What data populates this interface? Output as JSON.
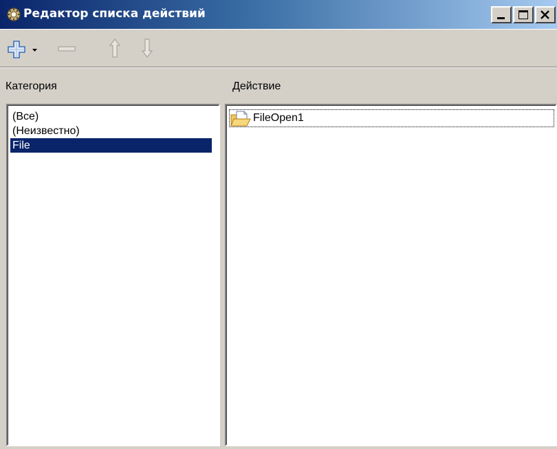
{
  "window": {
    "title": "Редактор списка действий",
    "title_icon": "actionlist-editor-icon",
    "caption_buttons": [
      "minimize-icon",
      "maximize-icon",
      "close-icon"
    ],
    "colors": {
      "titlebar_start": "#0a246a",
      "titlebar_end": "#a6caf0",
      "selection": "#0a246a",
      "face": "#d4d0c8"
    }
  },
  "toolbar": {
    "buttons": [
      {
        "icon": "add-icon",
        "has_dropdown": true,
        "enabled": true
      },
      {
        "icon": "remove-icon",
        "enabled": false
      },
      {
        "icon": "move-up-icon",
        "enabled": false
      },
      {
        "icon": "move-down-icon",
        "enabled": false
      }
    ]
  },
  "categories": {
    "header": "Категория",
    "items": [
      "(Все)",
      "(Неизвестно)",
      "File"
    ],
    "selected": "File"
  },
  "actions": {
    "header": "Действие",
    "items": [
      {
        "name": "FileOpen1",
        "icon": "file-open-icon",
        "focused": true
      }
    ]
  }
}
